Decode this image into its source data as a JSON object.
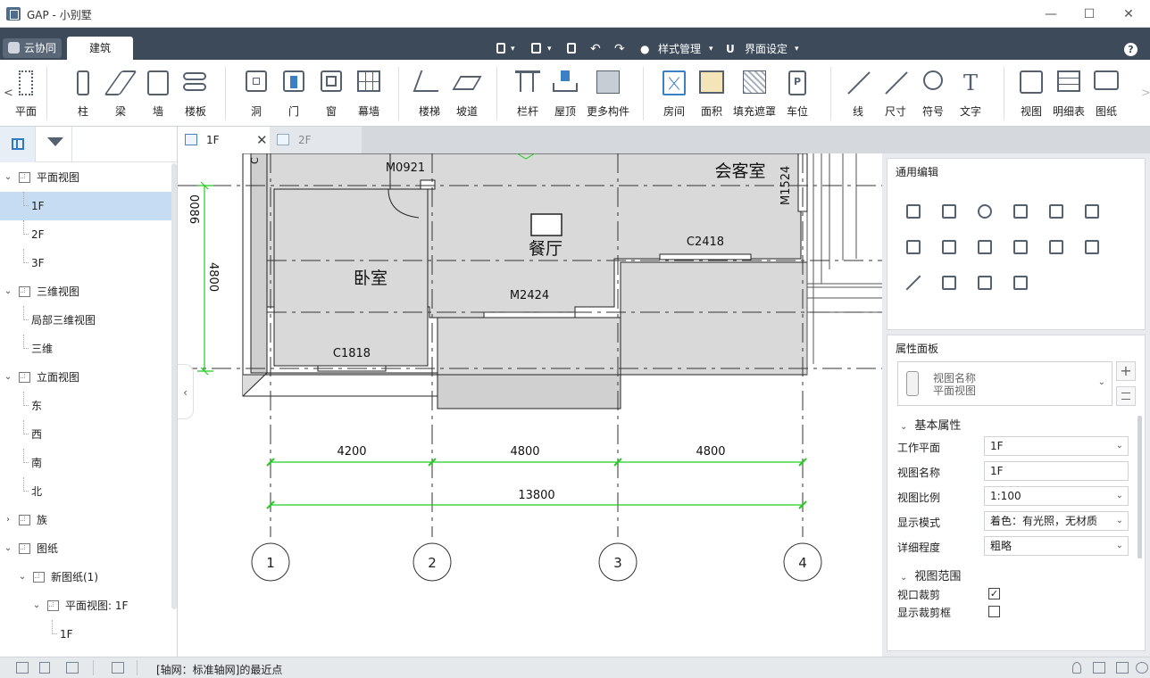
{
  "window": {
    "title": "GAP - 小别墅",
    "controls": {
      "minimize": "—",
      "maximize": "☐",
      "close": "✕"
    }
  },
  "menubar": {
    "cloud_tab": "云协同",
    "active_tab": "建筑",
    "style_manage": "样式管理",
    "ui_settings": "界面设定",
    "help": "?"
  },
  "ribbon": {
    "left_arrow": "<",
    "right_arrow": ">",
    "tools": [
      {
        "label": "平面",
        "icon": "plane-icon"
      },
      {
        "label": "柱",
        "icon": "column-icon"
      },
      {
        "label": "梁",
        "icon": "beam-icon"
      },
      {
        "label": "墙",
        "icon": "wall-icon"
      },
      {
        "label": "楼板",
        "icon": "floor-slab-icon"
      },
      {
        "label": "洞",
        "icon": "opening-icon"
      },
      {
        "label": "门",
        "icon": "door-icon"
      },
      {
        "label": "窗",
        "icon": "window-icon"
      },
      {
        "label": "幕墙",
        "icon": "curtain-wall-icon"
      },
      {
        "label": "楼梯",
        "icon": "stair-icon"
      },
      {
        "label": "坡道",
        "icon": "ramp-icon"
      },
      {
        "label": "栏杆",
        "icon": "railing-icon"
      },
      {
        "label": "屋顶",
        "icon": "roof-icon"
      },
      {
        "label": "更多构件",
        "icon": "more-components-icon"
      },
      {
        "label": "房间",
        "icon": "room-icon"
      },
      {
        "label": "面积",
        "icon": "area-icon"
      },
      {
        "label": "填充遮罩",
        "icon": "fill-mask-icon"
      },
      {
        "label": "车位",
        "icon": "parking-icon"
      },
      {
        "label": "线",
        "icon": "line-icon"
      },
      {
        "label": "尺寸",
        "icon": "dimension-icon"
      },
      {
        "label": "符号",
        "icon": "symbol-icon"
      },
      {
        "label": "文字",
        "icon": "text-icon"
      },
      {
        "label": "视图",
        "icon": "view-icon"
      },
      {
        "label": "明细表",
        "icon": "schedule-icon"
      },
      {
        "label": "图纸",
        "icon": "sheet-icon"
      }
    ]
  },
  "tree": {
    "items": [
      {
        "label": "平面视图",
        "level": 0,
        "toggle": "⌄"
      },
      {
        "label": "1F",
        "level": 1,
        "selected": true
      },
      {
        "label": "2F",
        "level": 1
      },
      {
        "label": "3F",
        "level": 1
      },
      {
        "label": "三维视图",
        "level": 0,
        "toggle": "⌄"
      },
      {
        "label": "局部三维视图",
        "level": 1
      },
      {
        "label": "三维",
        "level": 1
      },
      {
        "label": "立面视图",
        "level": 0,
        "toggle": "⌄"
      },
      {
        "label": "东",
        "level": 1
      },
      {
        "label": "西",
        "level": 1
      },
      {
        "label": "南",
        "level": 1
      },
      {
        "label": "北",
        "level": 1
      },
      {
        "label": "族",
        "level": 0,
        "toggle": "›"
      },
      {
        "label": "图纸",
        "level": 0,
        "toggle": "⌄"
      },
      {
        "label": "新图纸(1)",
        "level": 1,
        "toggle": "⌄"
      },
      {
        "label": "平面视图: 1F",
        "level": 2,
        "toggle": "⌄"
      },
      {
        "label": "1F",
        "level": 3
      }
    ]
  },
  "tabs": {
    "active": "1F",
    "inactive": "2F",
    "close": "✕"
  },
  "drawing": {
    "rooms": {
      "living": "会客室",
      "dining": "餐厅",
      "bedroom": "卧室"
    },
    "doors": {
      "m0921": "M0921",
      "m2424": "M2424",
      "m1524": "M1524"
    },
    "windows": {
      "c2418": "C2418",
      "c1818": "C1818"
    },
    "cut_left_mark": "C",
    "vertical_dims": {
      "top": "0086",
      "mid": "4800"
    },
    "dims": {
      "d1": "4200",
      "d2": "4800",
      "d3": "4800",
      "total": "13800"
    },
    "axes": [
      "1",
      "2",
      "3",
      "4"
    ],
    "line_color": "#1a1a1a",
    "dim_color": "#22cc22"
  },
  "edit_panel": {
    "title": "通用编辑",
    "icons": [
      "move-icon",
      "copy-icon",
      "rotate-icon",
      "split-icon",
      "align-icon",
      "offset-icon",
      "array-icon",
      "trim-icon",
      "extend-icon",
      "mirror-line-icon",
      "group-icon",
      "mirror-icon",
      "delete-icon",
      "stretch-icon",
      "match-icon",
      "measure-icon"
    ]
  },
  "properties": {
    "title": "属性面板",
    "type_name_label": "视图名称",
    "type_name_value": "平面视图",
    "basic_section": "基本属性",
    "rows": [
      {
        "label": "工作平面",
        "value": "1F",
        "dropdown": true
      },
      {
        "label": "视图名称",
        "value": "1F",
        "dropdown": false
      },
      {
        "label": "视图比例",
        "value": "1:100",
        "dropdown": true
      },
      {
        "label": "显示模式",
        "value": "着色：有光照，无材质",
        "dropdown": true
      },
      {
        "label": "详细程度",
        "value": "粗略",
        "dropdown": true
      }
    ],
    "range_section": "视图范围",
    "checks": [
      {
        "label": "视口裁剪",
        "checked": true,
        "mark": "✓"
      },
      {
        "label": "显示裁剪框",
        "checked": false,
        "mark": ""
      }
    ],
    "add": "+"
  },
  "status": {
    "text": "[轴网：标准轴网]的最近点"
  },
  "colors": {
    "menubar": "#3d4a59",
    "selection": "#c6dcf3",
    "accent": "#2f79c4"
  }
}
